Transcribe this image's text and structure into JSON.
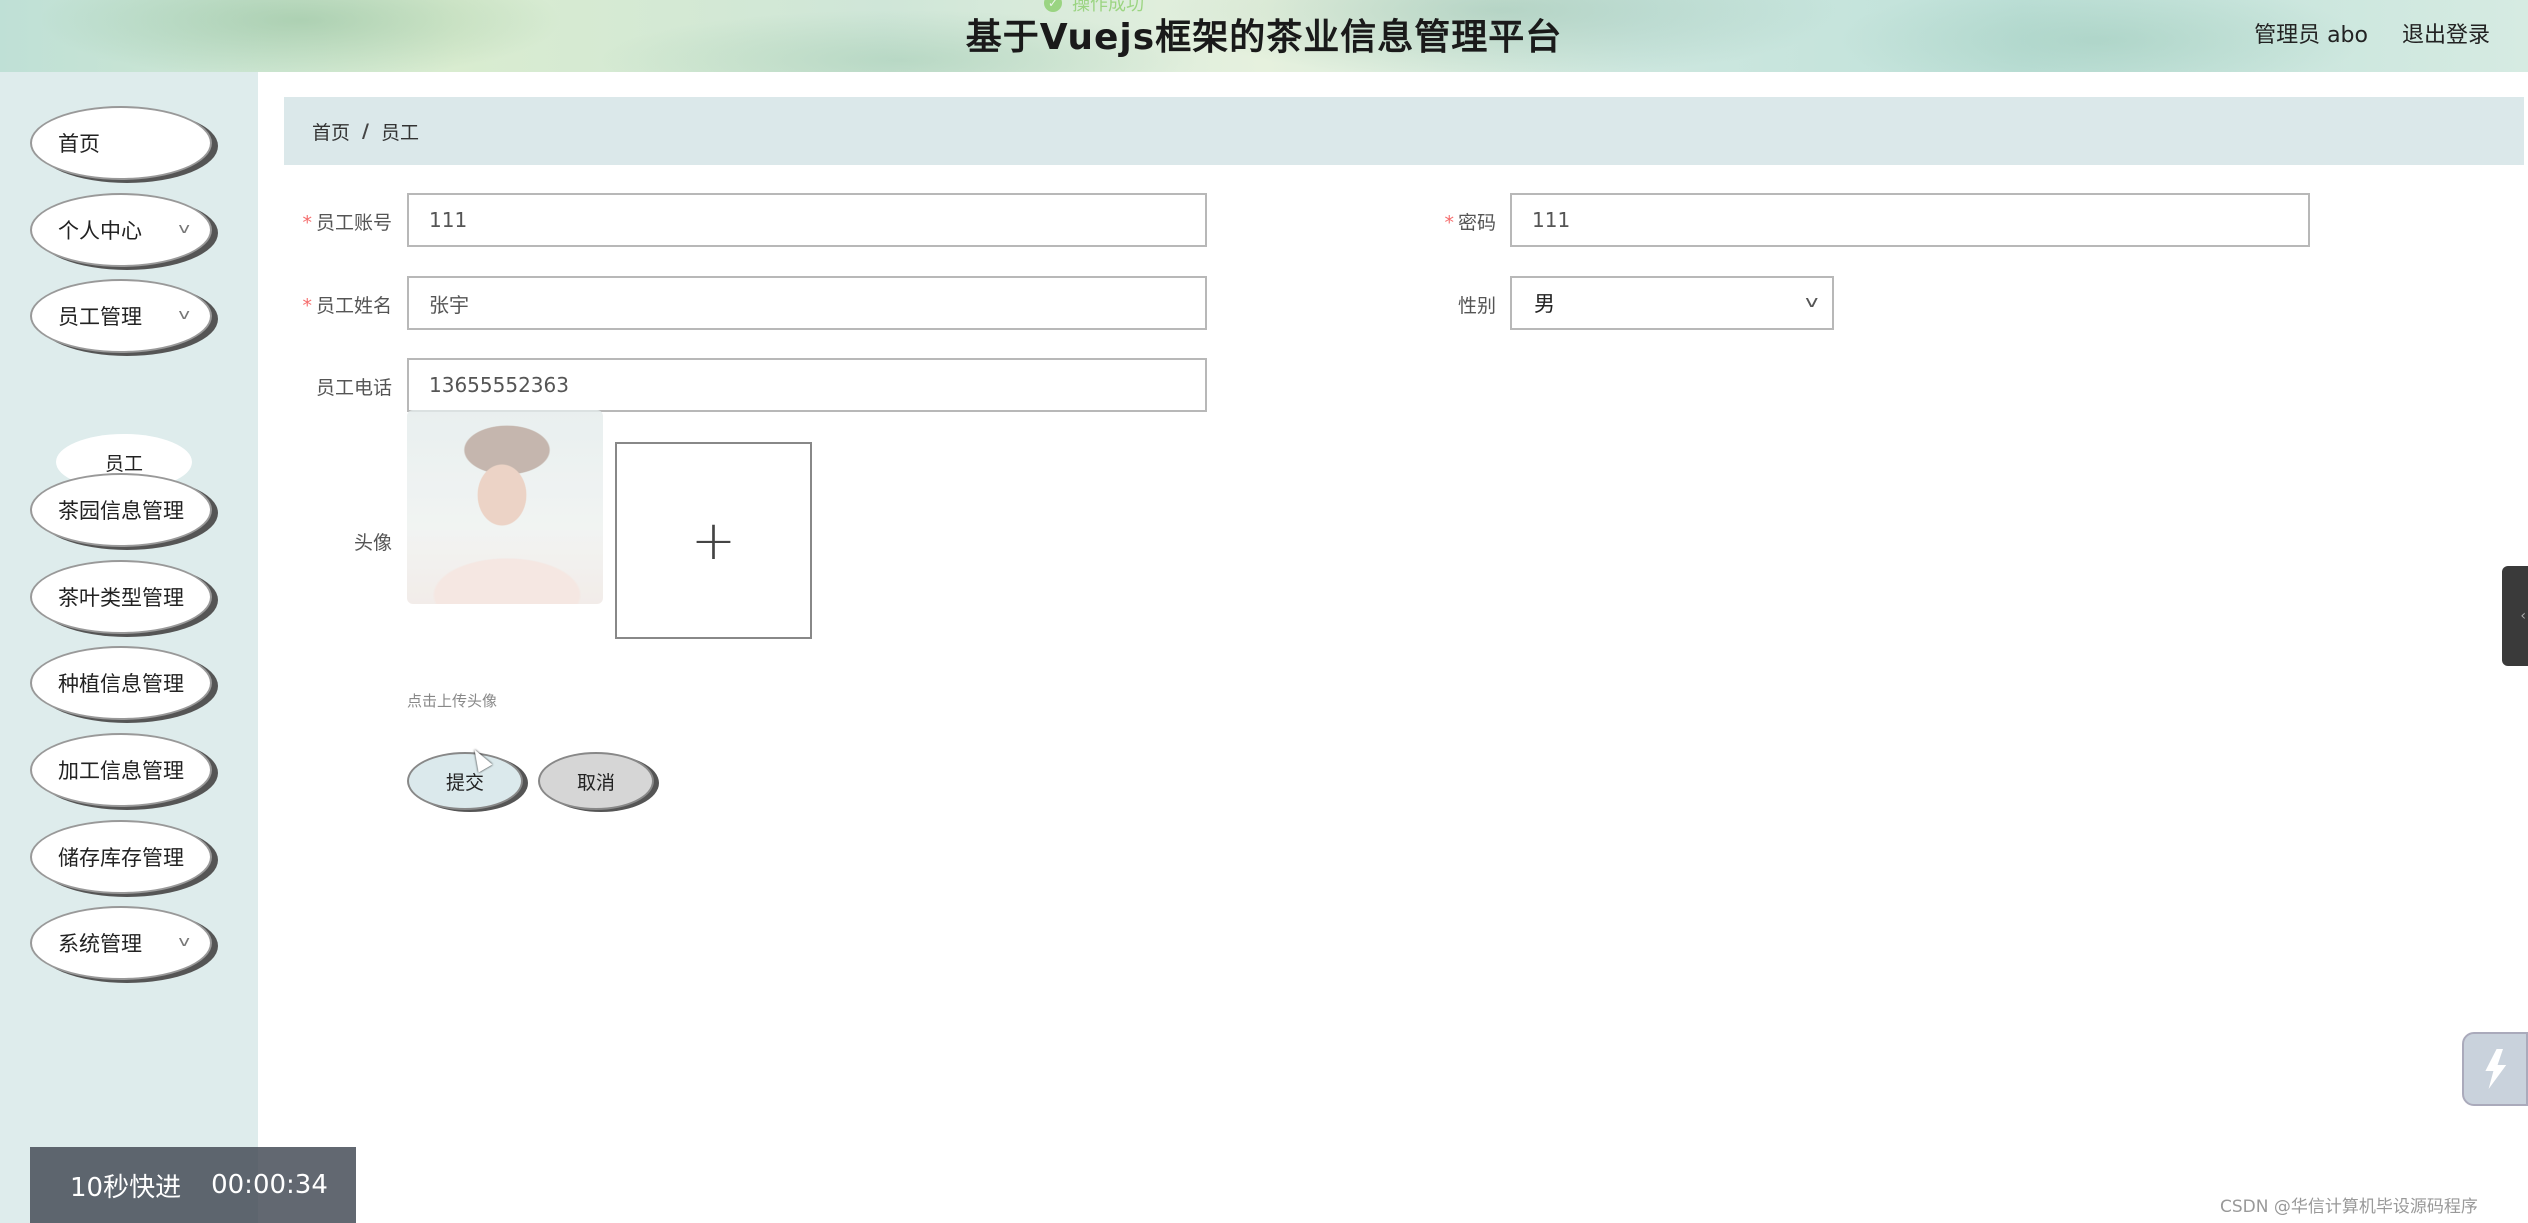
{
  "header": {
    "toast_text": "操作成功",
    "title": "基于Vuejs框架的茶业信息管理平台",
    "user_label": "管理员 abo",
    "logout": "退出登录"
  },
  "sidebar": {
    "items": [
      {
        "label": "首页"
      },
      {
        "label": "个人中心"
      },
      {
        "label": "员工管理"
      },
      {
        "label": "茶园信息管理"
      },
      {
        "label": "茶叶类型管理"
      },
      {
        "label": "种植信息管理"
      },
      {
        "label": "加工信息管理"
      },
      {
        "label": "储存库存管理"
      },
      {
        "label": "系统管理"
      }
    ],
    "submenu_item": "员工"
  },
  "breadcrumb": {
    "home": "首页",
    "separator": "/",
    "current": "员工"
  },
  "form": {
    "required_mark": "*",
    "account_label": "员工账号",
    "account_value": "111",
    "password_label": "密码",
    "password_value": "111",
    "name_label": "员工姓名",
    "name_value": "张宇",
    "gender_label": "性别",
    "gender_value": "男",
    "phone_label": "员工电话",
    "phone_value": "13655552363",
    "avatar_label": "头像",
    "upload_plus": "+",
    "upload_tip": "点击上传头像",
    "submit": "提交",
    "cancel": "取消"
  },
  "overlay": {
    "fast_forward": "10秒快进",
    "timer": "00:00:34"
  },
  "watermark": "CSDN @华信计算机毕设源码程序",
  "colors": {
    "required": "#f56c6c",
    "sidebar_bg": "#deecec",
    "breadcrumb_bg": "#dbe8ea",
    "toast": "#67c23a"
  }
}
